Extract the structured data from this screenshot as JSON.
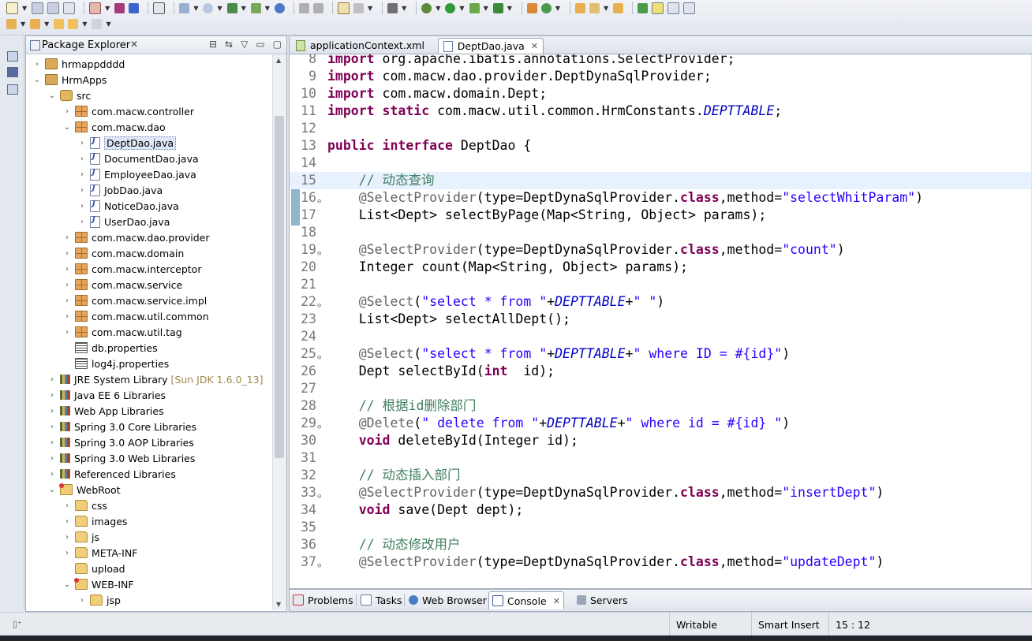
{
  "colors": {
    "keyword": "#7f0055",
    "annotation": "#646464",
    "string": "#2a00ff",
    "constant": "#0000c0",
    "comment": "#3f7f5f",
    "current_line": "#e8f2fe"
  },
  "package_explorer": {
    "title": "Package Explorer",
    "close": "✕",
    "tree": [
      {
        "label": "hrmappdddd",
        "icon": "project-icon",
        "expanded": false
      },
      {
        "label": "HrmApps",
        "icon": "project-icon",
        "expanded": true
      },
      {
        "label": "src",
        "icon": "source-folder-icon",
        "expanded": true
      },
      {
        "label": "com.macw.controller",
        "icon": "package-icon",
        "expanded": false
      },
      {
        "label": "com.macw.dao",
        "icon": "package-icon",
        "expanded": true
      },
      {
        "label": "DeptDao.java",
        "icon": "java-file-icon",
        "expanded": false,
        "selected": true
      },
      {
        "label": "DocumentDao.java",
        "icon": "java-file-icon",
        "expanded": false
      },
      {
        "label": "EmployeeDao.java",
        "icon": "java-file-icon",
        "expanded": false
      },
      {
        "label": "JobDao.java",
        "icon": "java-file-icon",
        "expanded": false
      },
      {
        "label": "NoticeDao.java",
        "icon": "java-file-icon",
        "expanded": false
      },
      {
        "label": "UserDao.java",
        "icon": "java-file-icon",
        "expanded": false
      },
      {
        "label": "com.macw.dao.provider",
        "icon": "package-icon",
        "expanded": false
      },
      {
        "label": "com.macw.domain",
        "icon": "package-icon",
        "expanded": false
      },
      {
        "label": "com.macw.interceptor",
        "icon": "package-icon",
        "expanded": false
      },
      {
        "label": "com.macw.service",
        "icon": "package-icon",
        "expanded": false
      },
      {
        "label": "com.macw.service.impl",
        "icon": "package-icon",
        "expanded": false
      },
      {
        "label": "com.macw.util.common",
        "icon": "package-icon",
        "expanded": false
      },
      {
        "label": "com.macw.util.tag",
        "icon": "package-icon",
        "expanded": false
      },
      {
        "label": "db.properties",
        "icon": "properties-file-icon"
      },
      {
        "label": "log4j.properties",
        "icon": "properties-file-icon"
      },
      {
        "label": "JRE System Library",
        "suffix": "[Sun JDK 1.6.0_13]",
        "icon": "library-icon",
        "expanded": false
      },
      {
        "label": "Java EE 6 Libraries",
        "icon": "library-icon",
        "expanded": false
      },
      {
        "label": "Web App Libraries",
        "icon": "library-icon",
        "expanded": false
      },
      {
        "label": "Spring 3.0 Core Libraries",
        "icon": "library-icon",
        "expanded": false
      },
      {
        "label": "Spring 3.0 AOP Libraries",
        "icon": "library-icon",
        "expanded": false
      },
      {
        "label": "Spring 3.0 Web Libraries",
        "icon": "library-icon",
        "expanded": false
      },
      {
        "label": "Referenced Libraries",
        "icon": "library-icon",
        "expanded": false
      },
      {
        "label": "WebRoot",
        "icon": "web-folder-icon",
        "expanded": true
      },
      {
        "label": "css",
        "icon": "folder-icon",
        "expanded": false
      },
      {
        "label": "images",
        "icon": "folder-icon",
        "expanded": false
      },
      {
        "label": "js",
        "icon": "folder-icon",
        "expanded": false
      },
      {
        "label": "META-INF",
        "icon": "folder-icon",
        "expanded": false
      },
      {
        "label": "upload",
        "icon": "folder-icon"
      },
      {
        "label": "WEB-INF",
        "icon": "web-folder-icon",
        "expanded": true
      },
      {
        "label": "jsp",
        "icon": "folder-icon",
        "expanded": false
      }
    ]
  },
  "editor": {
    "tabs": [
      {
        "label": "applicationContext.xml",
        "active": false
      },
      {
        "label": "DeptDao.java",
        "active": true,
        "close": "✕"
      }
    ],
    "lines": [
      {
        "n": "8",
        "fold": "",
        "tokens": [
          [
            "kw",
            "import"
          ],
          [
            "",
            "org.apache.ibatis.annotations.SelectProvider;"
          ]
        ]
      },
      {
        "n": "9",
        "fold": "",
        "tokens": [
          [
            "kw",
            "import"
          ],
          [
            "",
            "com.macw.dao.provider.DeptDynaSqlProvider;"
          ]
        ]
      },
      {
        "n": "10",
        "fold": "",
        "tokens": [
          [
            "kw",
            "import"
          ],
          [
            "",
            "com.macw.domain.Dept;"
          ]
        ]
      },
      {
        "n": "11",
        "fold": "",
        "tokens": [
          [
            "kw",
            "import"
          ],
          [
            "kw",
            "static"
          ],
          [
            "",
            "com.macw.util.common.HrmConstants."
          ],
          [
            "const",
            "DEPTTABLE"
          ],
          [
            "",
            ";"
          ]
        ]
      },
      {
        "n": "12",
        "fold": "",
        "tokens": []
      },
      {
        "n": "13",
        "fold": "",
        "tokens": [
          [
            "kw",
            "public"
          ],
          [
            "kw",
            "interface"
          ],
          [
            "",
            "DeptDao {"
          ]
        ]
      },
      {
        "n": "14",
        "fold": "",
        "tokens": []
      },
      {
        "n": "15",
        "fold": "",
        "current": true,
        "tokens": [
          [
            "cm",
            "    // 动态查询"
          ]
        ]
      },
      {
        "n": "16",
        "fold": "⊖",
        "tokens": [
          [
            "an",
            "    @SelectProvider"
          ],
          [
            "",
            "(type=DeptDynaSqlProvider."
          ],
          [
            "kw",
            "class"
          ],
          [
            "",
            ",method="
          ],
          [
            "str",
            "\"selectWhitParam\""
          ],
          [
            "",
            ")"
          ]
        ]
      },
      {
        "n": "17",
        "fold": "",
        "tokens": [
          [
            "",
            "    List<Dept> selectByPage(Map<String, Object> params);"
          ]
        ]
      },
      {
        "n": "18",
        "fold": "",
        "tokens": []
      },
      {
        "n": "19",
        "fold": "⊖",
        "tokens": [
          [
            "an",
            "    @SelectProvider"
          ],
          [
            "",
            "(type=DeptDynaSqlProvider."
          ],
          [
            "kw",
            "class"
          ],
          [
            "",
            ",method="
          ],
          [
            "str",
            "\"count\""
          ],
          [
            "",
            ")"
          ]
        ]
      },
      {
        "n": "20",
        "fold": "",
        "tokens": [
          [
            "",
            "    Integer count(Map<String, Object> params);"
          ]
        ]
      },
      {
        "n": "21",
        "fold": "",
        "tokens": []
      },
      {
        "n": "22",
        "fold": "⊖",
        "tokens": [
          [
            "an",
            "    @Select"
          ],
          [
            "",
            "("
          ],
          [
            "str",
            "\"select * from \""
          ],
          [
            "",
            "+"
          ],
          [
            "const",
            "DEPTTABLE"
          ],
          [
            "",
            "+"
          ],
          [
            "str",
            "\" \""
          ],
          [
            "",
            ")"
          ]
        ]
      },
      {
        "n": "23",
        "fold": "",
        "tokens": [
          [
            "",
            "    List<Dept> selectAllDept();"
          ]
        ]
      },
      {
        "n": "24",
        "fold": "",
        "tokens": []
      },
      {
        "n": "25",
        "fold": "⊖",
        "tokens": [
          [
            "an",
            "    @Select"
          ],
          [
            "",
            "("
          ],
          [
            "str",
            "\"select * from \""
          ],
          [
            "",
            "+"
          ],
          [
            "const",
            "DEPTTABLE"
          ],
          [
            "",
            "+"
          ],
          [
            "str",
            "\" where ID = #{id}\""
          ],
          [
            "",
            ")"
          ]
        ]
      },
      {
        "n": "26",
        "fold": "",
        "tokens": [
          [
            "",
            "    Dept selectById("
          ],
          [
            "kw",
            "int"
          ],
          [
            "",
            " id);"
          ]
        ]
      },
      {
        "n": "27",
        "fold": "",
        "tokens": []
      },
      {
        "n": "28",
        "fold": "",
        "tokens": [
          [
            "cm",
            "    // 根据id删除部门"
          ]
        ]
      },
      {
        "n": "29",
        "fold": "⊖",
        "tokens": [
          [
            "an",
            "    @Delete"
          ],
          [
            "",
            "("
          ],
          [
            "str",
            "\" delete from \""
          ],
          [
            "",
            "+"
          ],
          [
            "const",
            "DEPTTABLE"
          ],
          [
            "",
            "+"
          ],
          [
            "str",
            "\" where id = #{id} \""
          ],
          [
            "",
            ")"
          ]
        ]
      },
      {
        "n": "30",
        "fold": "",
        "tokens": [
          [
            "kw",
            "    void"
          ],
          [
            "",
            "deleteById(Integer id);"
          ]
        ]
      },
      {
        "n": "31",
        "fold": "",
        "tokens": []
      },
      {
        "n": "32",
        "fold": "",
        "tokens": [
          [
            "cm",
            "    // 动态插入部门"
          ]
        ]
      },
      {
        "n": "33",
        "fold": "⊖",
        "tokens": [
          [
            "an",
            "    @SelectProvider"
          ],
          [
            "",
            "(type=DeptDynaSqlProvider."
          ],
          [
            "kw",
            "class"
          ],
          [
            "",
            ",method="
          ],
          [
            "str",
            "\"insertDept\""
          ],
          [
            "",
            ")"
          ]
        ]
      },
      {
        "n": "34",
        "fold": "",
        "tokens": [
          [
            "kw",
            "    void"
          ],
          [
            "",
            "save(Dept dept);"
          ]
        ]
      },
      {
        "n": "35",
        "fold": "",
        "tokens": []
      },
      {
        "n": "36",
        "fold": "",
        "tokens": [
          [
            "cm",
            "    // 动态修改用户"
          ]
        ]
      },
      {
        "n": "37",
        "fold": "⊖",
        "tokens": [
          [
            "an",
            "    @SelectProvider"
          ],
          [
            "",
            "(type=DeptDynaSqlProvider."
          ],
          [
            "kw",
            "class"
          ],
          [
            "",
            ",method="
          ],
          [
            "str",
            "\"updateDept\""
          ],
          [
            "",
            ")"
          ]
        ]
      }
    ]
  },
  "bottom_panel": {
    "tabs": [
      {
        "label": "Problems",
        "icon": "problems-icon"
      },
      {
        "label": "Tasks",
        "icon": "tasks-icon"
      },
      {
        "label": "Web Browser",
        "icon": "globe-icon"
      },
      {
        "label": "Console",
        "icon": "console-icon",
        "active": true,
        "close": "✕"
      },
      {
        "label": "Servers",
        "icon": "servers-icon"
      }
    ]
  },
  "status": {
    "writable": "Writable",
    "insert_mode": "Smart Insert",
    "position": "15 : 12"
  }
}
